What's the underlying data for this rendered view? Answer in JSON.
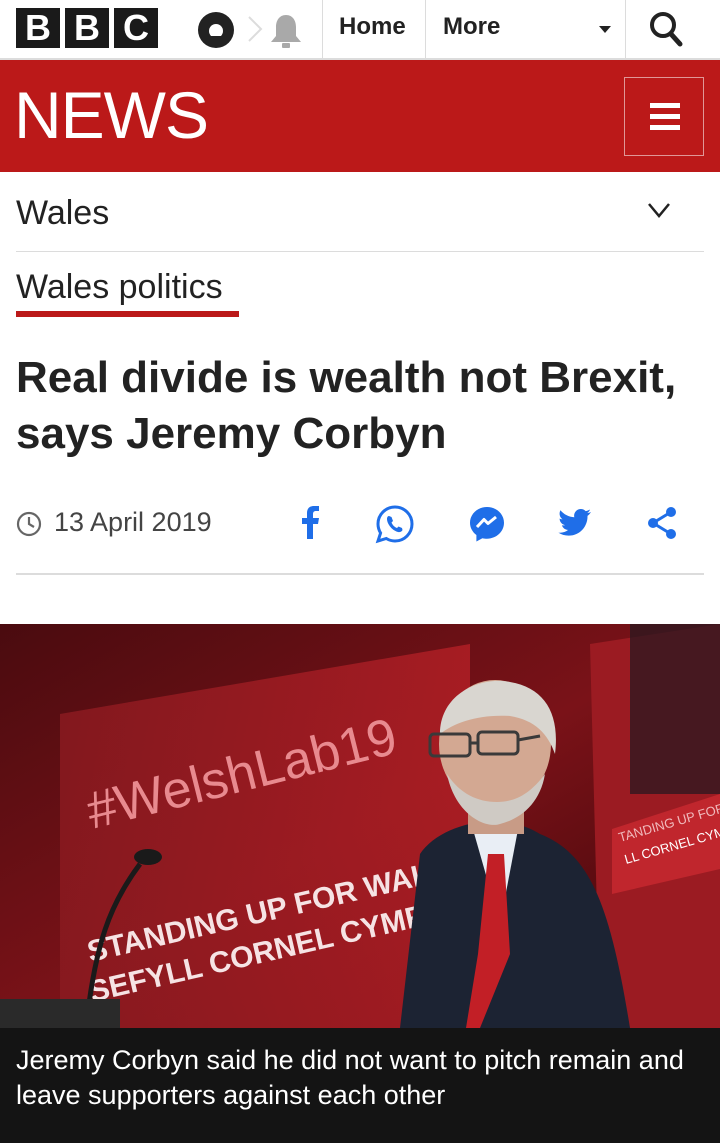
{
  "topbar": {
    "logo_letters": [
      "B",
      "B",
      "C"
    ],
    "icons": [
      "account-icon",
      "bell-icon",
      "search-icon"
    ],
    "nav": {
      "home": "Home",
      "more": "More"
    }
  },
  "news_banner": {
    "title": "NEWS",
    "menu_icon": "hamburger-icon"
  },
  "section": {
    "label": "Wales",
    "icon": "chevron-down-icon"
  },
  "subsection": {
    "label": "Wales politics",
    "accent": "#bb1919"
  },
  "article": {
    "headline": "Real divide is wealth not Brexit, says Jeremy Corbyn",
    "date": "13 April 2019",
    "share_icons": [
      "facebook-icon",
      "whatsapp-icon",
      "messenger-icon",
      "twitter-icon",
      "share-icon"
    ]
  },
  "hero_image": {
    "stage_text": "#WelshLab19",
    "banner_line1": "STANDING UP FOR WALES",
    "banner_line2": "SEFYLL CORNEL CYMRU",
    "screen_line1": "TANDING UP FOR W",
    "screen_line2": "LL CORNEL CYM",
    "caption": "Jeremy Corbyn said he did not want to pitch remain and leave supporters against each other"
  },
  "colors": {
    "brand_red": "#bb1919",
    "text": "#222222",
    "divider": "#dcdcdc",
    "share_color": "#1f6ee8"
  }
}
